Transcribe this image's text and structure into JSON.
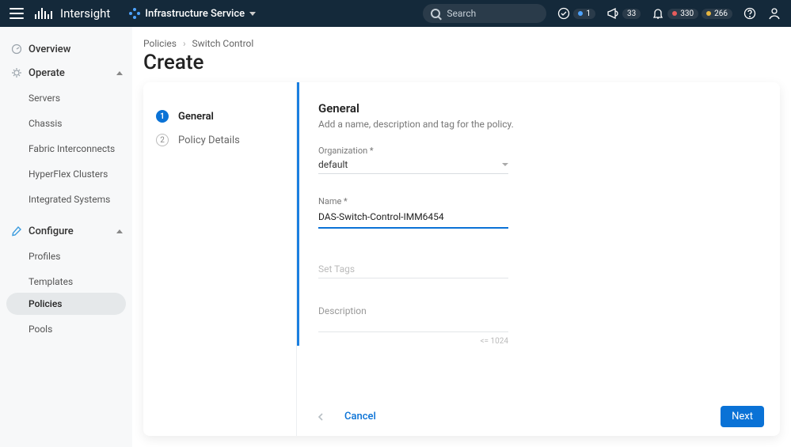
{
  "header": {
    "brand": "Intersight",
    "service": "Infrastructure Service",
    "search_placeholder": "Search",
    "badges": {
      "tasks": "1",
      "announcements": "33",
      "critical": "330",
      "warning": "266"
    }
  },
  "sidebar": {
    "overview": "Overview",
    "operate": {
      "label": "Operate",
      "items": [
        "Servers",
        "Chassis",
        "Fabric Interconnects",
        "HyperFlex Clusters",
        "Integrated Systems"
      ]
    },
    "configure": {
      "label": "Configure",
      "items": [
        "Profiles",
        "Templates",
        "Policies",
        "Pools"
      ],
      "active": "Policies"
    }
  },
  "page": {
    "crumbs": [
      "Policies",
      "Switch Control"
    ],
    "title": "Create"
  },
  "wizard": {
    "steps": [
      {
        "num": "1",
        "label": "General",
        "active": true
      },
      {
        "num": "2",
        "label": "Policy Details",
        "active": false
      }
    ],
    "form": {
      "heading": "General",
      "subtitle": "Add a name, description and tag for the policy.",
      "org_label": "Organization *",
      "org_value": "default",
      "name_label": "Name *",
      "name_value": "DAS-Switch-Control-IMM6454",
      "tags_placeholder": "Set Tags",
      "desc_label": "Description",
      "desc_limit": "<= 1024"
    },
    "buttons": {
      "cancel": "Cancel",
      "next": "Next"
    }
  }
}
